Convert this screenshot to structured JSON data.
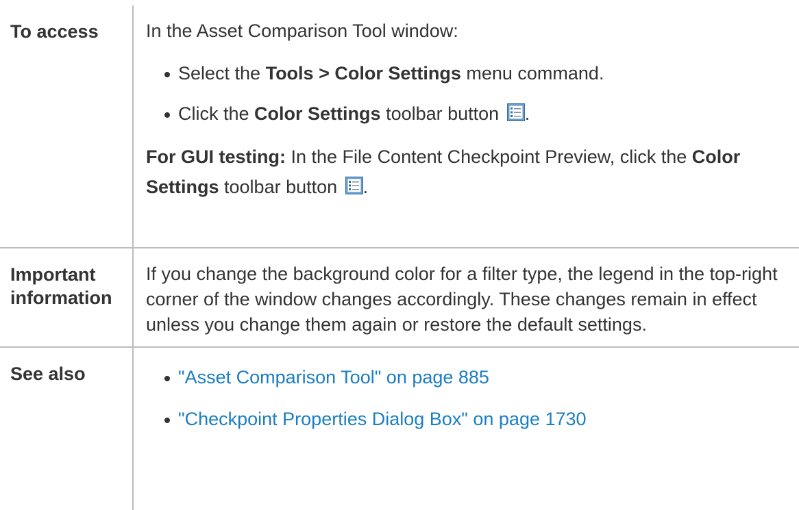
{
  "rows": {
    "access": {
      "label": "To access",
      "intro": "In the Asset Comparison Tool window:",
      "bullet1": {
        "prefix": "Select the ",
        "bold": "Tools > Color Settings",
        "suffix": " menu command."
      },
      "bullet2": {
        "prefix": "Click the ",
        "bold": "Color Settings",
        "suffix": " toolbar button",
        "after_icon": "."
      },
      "gui": {
        "bold_lead": "For GUI testing:",
        "text": " In the File Content Checkpoint Preview, click the ",
        "bold2": "Color Settings",
        "suffix": " toolbar button",
        "after_icon": "."
      },
      "icon": "color-settings-icon"
    },
    "important": {
      "label": "Important information",
      "text": "If you change the background color for a filter type, the legend in the top-right corner of the window changes accordingly. These changes remain in effect unless you change them again or restore the default settings."
    },
    "see_also": {
      "label": "See also",
      "links": [
        "\"Asset Comparison Tool\" on page 885",
        "\"Checkpoint Properties Dialog Box\" on page 1730"
      ]
    }
  },
  "colors": {
    "link": "#1a7ec3",
    "text": "#333333",
    "border": "#bdbdbd"
  }
}
